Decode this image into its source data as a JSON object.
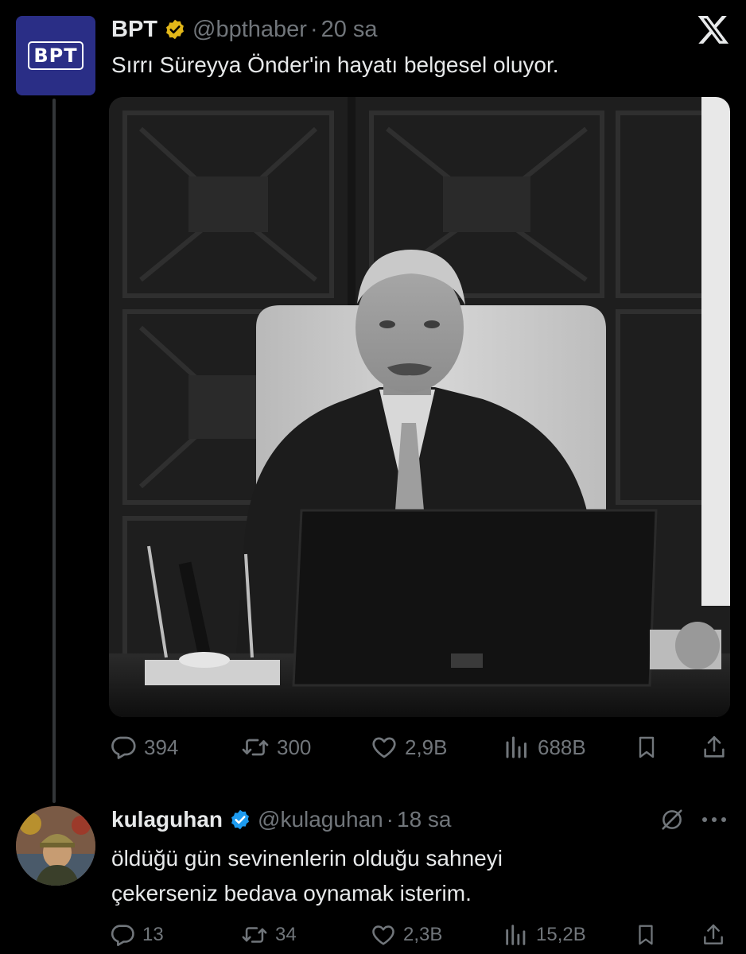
{
  "tweet1": {
    "author_name": "BPT",
    "avatar_text": "BPT",
    "handle": "@bpthaber",
    "separator": "·",
    "time": "20 sa",
    "text": "Sırrı Süreyya Önder'in hayatı belgesel oluyor.",
    "stats": {
      "replies": "394",
      "retweets": "300",
      "likes": "2,9B",
      "views": "688B"
    }
  },
  "tweet2": {
    "author_name": "kulaguhan",
    "handle": "@kulaguhan",
    "separator": "·",
    "time": "18 sa",
    "text_line1": "öldüğü gün sevinenlerin olduğu sahneyi",
    "text_line2": "çekerseniz bedava oynamak isterim.",
    "stats": {
      "replies": "13",
      "retweets": "34",
      "likes": "2,3B",
      "views": "15,2B"
    }
  },
  "icons": {
    "verified": "verified-gold-badge-icon",
    "verified_blue": "verified-blue-badge-icon",
    "reply": "reply-icon",
    "retweet": "retweet-icon",
    "like": "heart-icon",
    "views": "views-icon",
    "bookmark": "bookmark-icon",
    "share": "share-icon",
    "brand": "x-logo-icon",
    "grok": "grok-icon",
    "more": "more-icon"
  },
  "colors": {
    "background": "#000000",
    "text": "#e7e9ea",
    "muted": "#71767b",
    "verified_gold": "#e2b719",
    "verified_blue": "#1d9bf0",
    "bpt_avatar": "#2a2e86"
  }
}
